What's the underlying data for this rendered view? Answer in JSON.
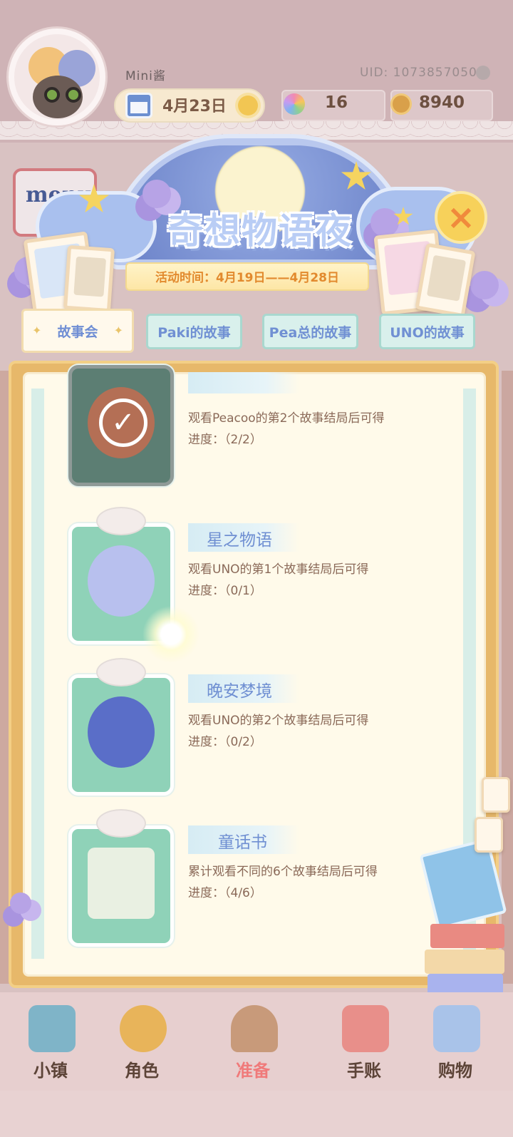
{
  "header": {
    "username": "Mini酱",
    "uid": "UID: 1073857050",
    "date": "4月23日",
    "gems": "16",
    "coins": "8940"
  },
  "decor": {
    "menu_board": "menu"
  },
  "event": {
    "title": "奇想物语夜",
    "period": "活动时间：4月19日——4月28日"
  },
  "tabs": [
    {
      "label": "故事会",
      "active": true
    },
    {
      "label": "Paki的故事",
      "active": false
    },
    {
      "label": "Pea总的故事",
      "active": false
    },
    {
      "label": "UNO的故事",
      "active": false
    }
  ],
  "rewards": [
    {
      "title": "",
      "desc": "观看Peacoo的第2个故事结局后可得",
      "progress": "进度：（2/2）",
      "completed": true
    },
    {
      "title": "星之物语",
      "desc": "观看UNO的第1个故事结局后可得",
      "progress": "进度：（0/1）",
      "completed": false
    },
    {
      "title": "晚安梦境",
      "desc": "观看UNO的第2个故事结局后可得",
      "progress": "进度：（0/2）",
      "completed": false
    },
    {
      "title": "童话书",
      "desc": "累计观看不同的6个故事结局后可得",
      "progress": "进度：（4/6）",
      "completed": false
    }
  ],
  "nav": [
    {
      "label": "小镇",
      "icon": "map-icon"
    },
    {
      "label": "角色",
      "icon": "character-icon"
    },
    {
      "label": "准备",
      "icon": "basket-icon"
    },
    {
      "label": "手账",
      "icon": "journal-icon"
    },
    {
      "label": "购物",
      "icon": "shopping-bag-icon"
    }
  ],
  "colors": {
    "tab_text": "#7090d3",
    "title_text": "#6f8fd2",
    "desc_text": "#8a6958",
    "frame": "#e7b86a",
    "panel": "#fffaea",
    "gift": "#8fd2b8"
  }
}
